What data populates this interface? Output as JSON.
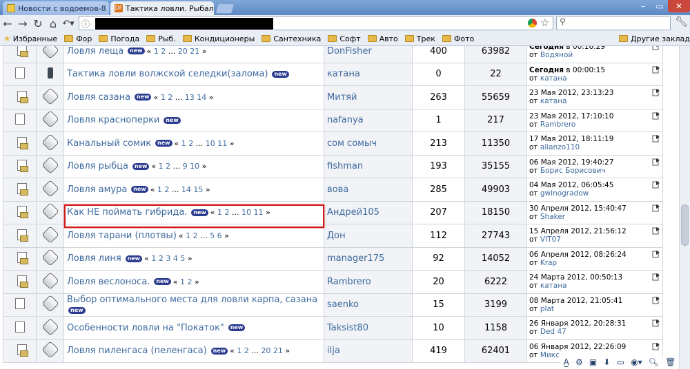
{
  "tabs": [
    {
      "title": "Новости с водоемов-8",
      "active": false
    },
    {
      "title": "Тактика ловли. Рыбал",
      "active": true
    }
  ],
  "bookmarks": {
    "items": [
      "Избранные",
      "Фор",
      "Погода",
      "Рыб.",
      "Кондиционеры",
      "Сантехника",
      "Софт",
      "Авто",
      "Трек",
      "Фото"
    ],
    "other": "Другие закладки"
  },
  "topics": [
    {
      "title": "Ловля леща",
      "new": true,
      "pages": [
        "«",
        "1",
        "2",
        "...",
        "20",
        "21",
        "»"
      ],
      "author": "DonFisher",
      "replies": "400",
      "views": "63982",
      "last_date": "Сегодня",
      "last_time": "в 00:16:29",
      "last_by_prefix": "от",
      "last_by": "Водяной",
      "icon": "multi"
    },
    {
      "title": "Тактика ловли волжской селедки(залома)",
      "new": true,
      "pages": [],
      "author": "катана",
      "replies": "0",
      "views": "22",
      "last_date": "Сегодня",
      "last_time": "в 00:00:15",
      "last_by_prefix": "от",
      "last_by": "катана",
      "icon": "single"
    },
    {
      "title": "Ловля сазана",
      "new": true,
      "pages": [
        "«",
        "1",
        "2",
        "...",
        "13",
        "14",
        "»"
      ],
      "author": "Митяй",
      "replies": "263",
      "views": "55659",
      "last_date": "",
      "last_time": "23 Мая 2012, 23:13:23",
      "last_by_prefix": "от",
      "last_by": "катана",
      "icon": "multi"
    },
    {
      "title": "Ловля красноперки",
      "new": true,
      "pages": [],
      "author": "nafanya",
      "replies": "1",
      "views": "217",
      "last_date": "",
      "last_time": "23 Мая 2012, 17:10:10",
      "last_by_prefix": "от",
      "last_by": "Rambrero",
      "icon": "single"
    },
    {
      "title": "Канальный сомик",
      "new": true,
      "pages": [
        "«",
        "1",
        "2",
        "...",
        "10",
        "11",
        "»"
      ],
      "author": "сом сомыч",
      "replies": "213",
      "views": "11350",
      "last_date": "",
      "last_time": "17 Мая 2012, 18:11:19",
      "last_by_prefix": "от",
      "last_by": "alianzo110",
      "icon": "multi"
    },
    {
      "title": "Ловля рыбца",
      "new": true,
      "pages": [
        "«",
        "1",
        "2",
        "...",
        "9",
        "10",
        "»"
      ],
      "author": "fishman",
      "replies": "193",
      "views": "35155",
      "last_date": "",
      "last_time": "06 Мая 2012, 19:40:27",
      "last_by_prefix": "от",
      "last_by": "Борис Борисович",
      "icon": "multi"
    },
    {
      "title": "Ловля амура",
      "new": true,
      "pages": [
        "«",
        "1",
        "2",
        "...",
        "14",
        "15",
        "»"
      ],
      "author": "вова",
      "replies": "285",
      "views": "49903",
      "last_date": "",
      "last_time": "04 Мая 2012, 06:05:45",
      "last_by_prefix": "от",
      "last_by": "gwinogradow",
      "icon": "multi"
    },
    {
      "title": "Как НЕ поймать гибрида.",
      "new": true,
      "pages": [
        "«",
        "1",
        "2",
        "...",
        "10",
        "11",
        "»"
      ],
      "author": "Андрей105",
      "replies": "207",
      "views": "18150",
      "last_date": "",
      "last_time": "30 Апреля 2012, 15:40:47",
      "last_by_prefix": "от",
      "last_by": "Shaker",
      "icon": "multi"
    },
    {
      "title": "Ловля тарани (плотвы)",
      "new": false,
      "pages": [
        "«",
        "1",
        "2",
        "...",
        "5",
        "6",
        "»"
      ],
      "author": "Дон",
      "replies": "112",
      "views": "27743",
      "last_date": "",
      "last_time": "15 Апреля 2012, 21:56:12",
      "last_by_prefix": "от",
      "last_by": "VIT07",
      "icon": "multi"
    },
    {
      "title": "Ловля линя",
      "new": true,
      "pages": [
        "«",
        "1",
        "2",
        "3",
        "4",
        "5",
        "»"
      ],
      "author": "manager175",
      "replies": "92",
      "views": "14052",
      "last_date": "",
      "last_time": "06 Апреля 2012, 08:26:24",
      "last_by_prefix": "от",
      "last_by": "Krap",
      "icon": "multi"
    },
    {
      "title": "Ловля веслоноса.",
      "new": true,
      "pages": [
        "«",
        "1",
        "2",
        "»"
      ],
      "author": "Rambrero",
      "replies": "20",
      "views": "6222",
      "last_date": "",
      "last_time": "24 Марта 2012, 00:50:13",
      "last_by_prefix": "от",
      "last_by": "катана",
      "icon": "multi"
    },
    {
      "title": "Выбор оптимального места для ловли карпа, сазана",
      "new": true,
      "pages": [],
      "author": "saenko",
      "replies": "15",
      "views": "3199",
      "last_date": "",
      "last_time": "08 Марта 2012, 21:05:41",
      "last_by_prefix": "от",
      "last_by": "plat",
      "icon": "single"
    },
    {
      "title": "Особенности ловли на \"Покаток\"",
      "new": true,
      "pages": [],
      "author": "Taksist80",
      "replies": "10",
      "views": "1158",
      "last_date": "",
      "last_time": "26 Января 2012, 20:28:31",
      "last_by_prefix": "от",
      "last_by": "Ded 47",
      "icon": "single"
    },
    {
      "title": "Ловля пиленгаса (пеленгаса)",
      "new": true,
      "pages": [
        "«",
        "1",
        "2",
        "...",
        "20",
        "21",
        "»"
      ],
      "author": "ilja",
      "replies": "419",
      "views": "62401",
      "last_date": "",
      "last_time": "06 Января 2012, 22:26:09",
      "last_by_prefix": "от",
      "last_by": "Микс",
      "icon": "multi"
    }
  ],
  "new_badge_label": "new",
  "colors": {
    "link": "#3e6a9e",
    "highlight": "#d11b1b",
    "new_badge": "#2a3b8f"
  }
}
